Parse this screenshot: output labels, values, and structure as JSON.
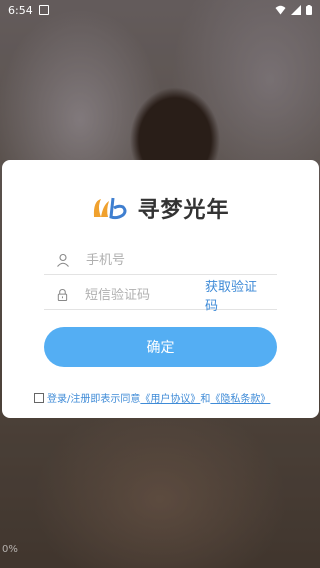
{
  "status_bar": {
    "time": "6:54"
  },
  "logo": {
    "brand_name": "寻梦光年",
    "accent_color": "#f0a12e",
    "accent_color_2": "#3f7fd0"
  },
  "form": {
    "phone_placeholder": "手机号",
    "code_placeholder": "短信验证码",
    "get_code_label": "获取验证码",
    "confirm_label": "确定"
  },
  "agreement": {
    "prefix": "登录/注册即表示同意",
    "user_agreement": "《用户协议》",
    "and": "和",
    "privacy_policy": "《隐私条款》",
    "checked": false
  },
  "colors": {
    "button": "#54aef3",
    "link": "#3f8bd7"
  },
  "background": {
    "corner_mark": "0%"
  }
}
